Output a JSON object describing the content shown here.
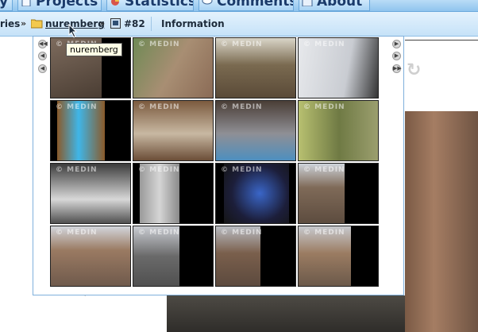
{
  "nav": {
    "tabs": [
      {
        "label": "y"
      },
      {
        "label": "Projects"
      },
      {
        "label": "Statistics"
      },
      {
        "label": "Comments"
      },
      {
        "label": "About"
      }
    ]
  },
  "breadcrumb": {
    "item0": "ries",
    "sep": "»",
    "item1": "nuremberg",
    "item2": "#82",
    "item3": "Information"
  },
  "tooltip": "nuremberg",
  "watermark": "© MEDIN",
  "thumbnails": [
    {
      "row": 0,
      "col": 0,
      "desc": "stone-wall-dark"
    },
    {
      "row": 0,
      "col": 1,
      "desc": "castle-path-greenery"
    },
    {
      "row": 0,
      "col": 2,
      "desc": "beer-garden-umbrellas"
    },
    {
      "row": 0,
      "col": 3,
      "desc": "kriego-coach-bus"
    },
    {
      "row": 1,
      "col": 0,
      "desc": "blue-light-sculpture"
    },
    {
      "row": 1,
      "col": 1,
      "desc": "conference-hall-audience"
    },
    {
      "row": 1,
      "col": 2,
      "desc": "hotel-bedroom"
    },
    {
      "row": 1,
      "col": 3,
      "desc": "green-hotel-hallway"
    },
    {
      "row": 2,
      "col": 0,
      "desc": "bathroom-sink"
    },
    {
      "row": 2,
      "col": 1,
      "desc": "glass-shower"
    },
    {
      "row": 2,
      "col": 2,
      "desc": "wave-painting-monitor"
    },
    {
      "row": 2,
      "col": 3,
      "desc": "stone-round-tower"
    },
    {
      "row": 3,
      "col": 0,
      "desc": "old-town-building"
    },
    {
      "row": 3,
      "col": 1,
      "desc": "gothic-fountain"
    },
    {
      "row": 3,
      "col": 2,
      "desc": "church-spire-street"
    },
    {
      "row": 3,
      "col": 3,
      "desc": "sandstone-tower-square"
    }
  ],
  "stray_text": "/>"
}
